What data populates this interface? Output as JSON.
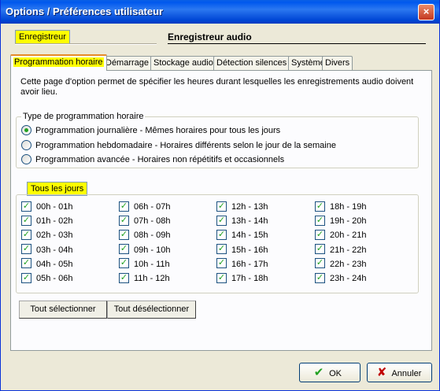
{
  "window": {
    "title": "Options / Préférences utilisateur",
    "close_glyph": "×"
  },
  "header": {
    "section_label": "Enregistreur",
    "title": "Enregistreur audio"
  },
  "tabs": [
    {
      "label": "Programmation horaire",
      "active": true
    },
    {
      "label": "Démarrage",
      "active": false
    },
    {
      "label": "Stockage audio",
      "active": false
    },
    {
      "label": "Détection silences",
      "active": false
    },
    {
      "label": "Système",
      "active": false
    },
    {
      "label": "Divers",
      "active": false
    }
  ],
  "description": "Cette page d'option permet de spécifier les heures durant lesquelles les enregistrements audio doivent avoir lieu.",
  "schedule_type": {
    "legend": "Type de programmation horaire",
    "options": [
      {
        "label": "Programmation journalière - Mêmes horaires pour tous les jours",
        "checked": true
      },
      {
        "label": "Programmation hebdomadaire - Horaires différents selon le jour de la semaine",
        "checked": false
      },
      {
        "label": "Programmation avancée - Horaires non répétitifs et occasionnels",
        "checked": false
      }
    ]
  },
  "hours_group": {
    "label": "Tous les jours",
    "hours": [
      "00h - 01h",
      "01h - 02h",
      "02h - 03h",
      "03h - 04h",
      "04h - 05h",
      "05h - 06h",
      "06h - 07h",
      "07h - 08h",
      "08h - 09h",
      "09h - 10h",
      "10h - 11h",
      "11h - 12h",
      "12h - 13h",
      "13h - 14h",
      "14h - 15h",
      "15h - 16h",
      "16h - 17h",
      "17h - 18h",
      "18h - 19h",
      "19h - 20h",
      "20h - 21h",
      "21h - 22h",
      "22h - 23h",
      "23h - 24h"
    ]
  },
  "buttons": {
    "select_all": "Tout sélectionner",
    "deselect_all": "Tout désélectionner",
    "ok": "OK",
    "cancel": "Annuler",
    "ok_icon": "check-icon",
    "cancel_icon": "cross-icon"
  },
  "colors": {
    "highlight": "#ffff00",
    "check": "#21a121",
    "cancel_icon": "#c00000",
    "titlebar": "#0058ee"
  }
}
